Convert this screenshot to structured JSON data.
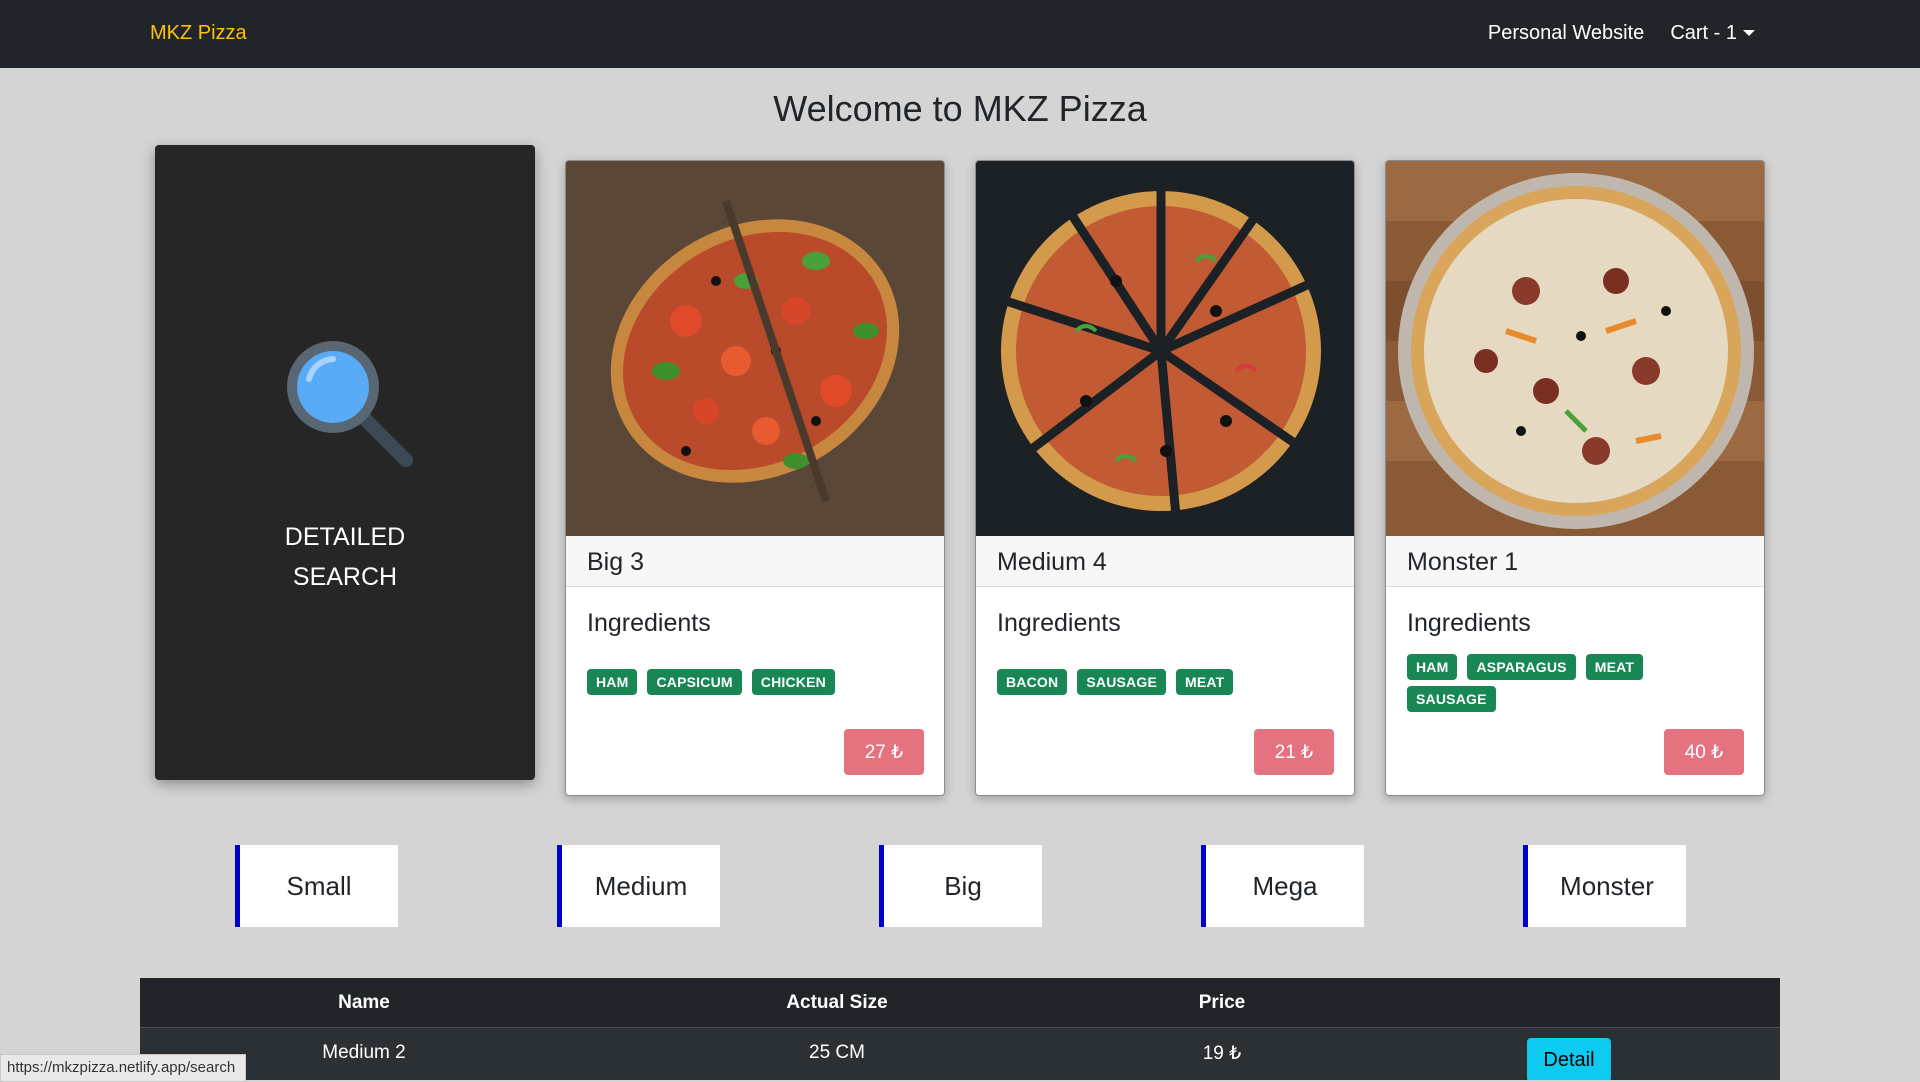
{
  "navbar": {
    "brand": "MKZ Pizza",
    "links": [
      "Personal Website",
      "Cart - 1"
    ],
    "colors": {
      "background": "#212529",
      "brand": "#ffc107"
    }
  },
  "main": {
    "title": "Welcome to MKZ Pizza"
  },
  "search_card": {
    "icon": "magnifier-icon",
    "line1": "DETAILED",
    "line2": "SEARCH"
  },
  "pizzas": [
    {
      "name": "Big 3",
      "ingredients_title": "Ingredients",
      "ingredients": [
        "HAM",
        "CAPSICUM",
        "CHICKEN"
      ],
      "price": "27 ₺"
    },
    {
      "name": "Medium 4",
      "ingredients_title": "Ingredients",
      "ingredients": [
        "BACON",
        "SAUSAGE",
        "MEAT"
      ],
      "price": "21 ₺"
    },
    {
      "name": "Monster 1",
      "ingredients_title": "Ingredients",
      "ingredients": [
        "HAM",
        "ASPARAGUS",
        "MEAT",
        "SAUSAGE"
      ],
      "price": "40 ₺"
    }
  ],
  "sizes": [
    "Small",
    "Medium",
    "Big",
    "Mega",
    "Monster"
  ],
  "table": {
    "headers": [
      "Name",
      "Actual Size",
      "Price"
    ],
    "rows": [
      {
        "name": "Medium 2",
        "size": "25 CM",
        "price": "19 ₺",
        "action": "Detail"
      }
    ]
  },
  "status_bar": {
    "url": "https://mkzpizza.netlify.app/search"
  },
  "colors": {
    "badge": "#198754",
    "price_button": "#e4737f",
    "detail_button": "#0dcaf0",
    "size_accent": "#0000cc"
  }
}
